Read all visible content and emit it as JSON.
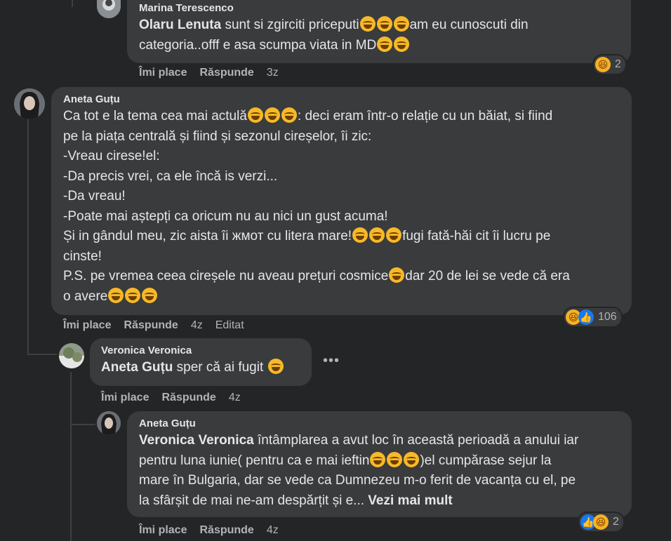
{
  "comments": [
    {
      "author": "Marina Terescenco",
      "mention": "Olaru Lenuta",
      "line1_after_mention": " sunt si zgirciti priceputi",
      "line1_end": "am eu cunoscuti din",
      "line2": "categoria..offf e asa scumpa viata in MD",
      "like": "Îmi place",
      "reply": "Răspunde",
      "time": "3z",
      "reaction_count": "2"
    },
    {
      "author": "Aneta Guțu",
      "l1a": "Ca tot e la tema cea mai actulă",
      "l1b": ": deci eram într-o relație cu un băiat, si fiind",
      "l2": "pe la piața centrală și fiind și sezonul cireșelor, îi zic:",
      "l3": "-Vreau cirese!el:",
      "l4": "-Da precis vrei, ca ele încă is verzi...",
      "l5": "-Da vreau!",
      "l6": "-Poate mai aștepți ca oricum nu au nici un gust acuma!",
      "l7a": "Și in gândul meu, zic aista îi жмот cu litera mare!",
      "l7b": "fugi fată-hăi cit îi lucru pe",
      "l8": "cinste!",
      "l9a": "P.S. pe vremea ceea cireșele nu aveau prețuri cosmice",
      "l9b": "dar 20 de lei se vede că era",
      "l10": "o avere",
      "like": "Îmi place",
      "reply": "Răspunde",
      "time": "4z",
      "edited": "Editat",
      "reaction_count": "106"
    },
    {
      "author": "Veronica Veronica",
      "mention": "Aneta Guțu",
      "text": " sper că ai fugit ",
      "like": "Îmi place",
      "reply": "Răspunde",
      "time": "4z"
    },
    {
      "author": "Aneta Guțu",
      "mention": "Veronica Veronica",
      "l1": " întâmplarea a avut loc în această perioadă a anului iar",
      "l2a": "pentru luna iunie( pentru ca e mai ieftin",
      "l2b": ")el cumpărase sejur la",
      "l3": "mare în Bulgaria, dar se vede ca Dumnezeu m-o ferit de vacanța cu el, pe",
      "l4": "la sfârșit de mai ne-am despărțit și e... ",
      "see_more": "Vezi mai mult",
      "like": "Îmi place",
      "reply": "Răspunde",
      "time": "4z",
      "reaction_count": "2"
    }
  ]
}
